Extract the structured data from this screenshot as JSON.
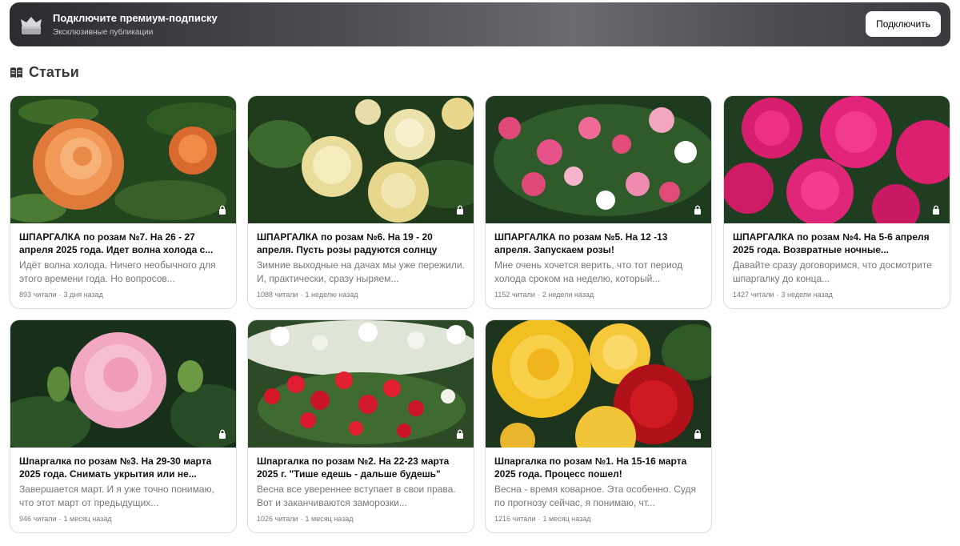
{
  "banner": {
    "title": "Подключите премиум-подписку",
    "subtitle": "Эксклюзивные публикации",
    "button_label": "Подключить"
  },
  "section": {
    "title": "Статьи"
  },
  "articles": [
    {
      "title": "ШПАРГАЛКА по розам №7. На 26 - 27 апреля 2025 года. Идет волна холода с...",
      "description": "Идёт волна холода. Ничего необычного для этого времени года. Но вопросов...",
      "reads": "893 читали",
      "age": "3 дня назад",
      "locked": true,
      "image": "orange-rose"
    },
    {
      "title": "ШПАРГАЛКА по розам №6. На 19 - 20 апреля. Пусть розы радуются солнцу",
      "description": "Зимние выходные на дачах мы уже пережили. И, практически, сразу ныряем...",
      "reads": "1088 читали",
      "age": "1 неделю назад",
      "locked": true,
      "image": "cream-roses"
    },
    {
      "title": "ШПАРГАЛКА по розам №5. На 12 -13 апреля. Запускаем розы!",
      "description": "Мне очень хочется верить, что тот период холода сроком на неделю, который...",
      "reads": "1152 читали",
      "age": "2 недели назад",
      "locked": true,
      "image": "pink-white-bush"
    },
    {
      "title": "ШПАРГАЛКА по розам №4. На 5-6 апреля 2025 года. Возвратные ночные...",
      "description": "Давайте сразу договоримся, что досмотрите шпаргалку до конца...",
      "reads": "1427 читали",
      "age": "3 недели назад",
      "locked": true,
      "image": "magenta-roses"
    },
    {
      "title": "Шпаргалка по розам №3. На 29-30 марта 2025 года. Снимать укрытия или не...",
      "description": "Завершается март. И я уже точно понимаю, что этот март от предыдущих...",
      "reads": "946 читали",
      "age": "1 месяц назад",
      "locked": true,
      "image": "pink-rose"
    },
    {
      "title": "Шпаргалка по розам №2. На 22-23 марта 2025 г. \"Тише едешь - дальше будешь\"",
      "description": "Весна все увереннее вступает в свои права. Вот и заканчиваются заморозки...",
      "reads": "1026 читали",
      "age": "1 месяц назад",
      "locked": true,
      "image": "red-white-garden"
    },
    {
      "title": "Шпаргалка по розам №1. На 15-16 марта 2025 года. Процесс пошел!",
      "description": "Весна - время коварное. Эта особенно. Судя по прогнозу сейчас, я понимаю, чт...",
      "reads": "1216 читали",
      "age": "1 месяц назад",
      "locked": true,
      "image": "yellow-red-roses"
    }
  ],
  "icons": {
    "banner": "crown-box-icon",
    "section": "articles-icon",
    "lock": "lock-icon"
  },
  "colors": {
    "banner_bg": "#3a3a3f",
    "button_bg": "#ffffff",
    "meta_text": "#7a7a7a"
  }
}
